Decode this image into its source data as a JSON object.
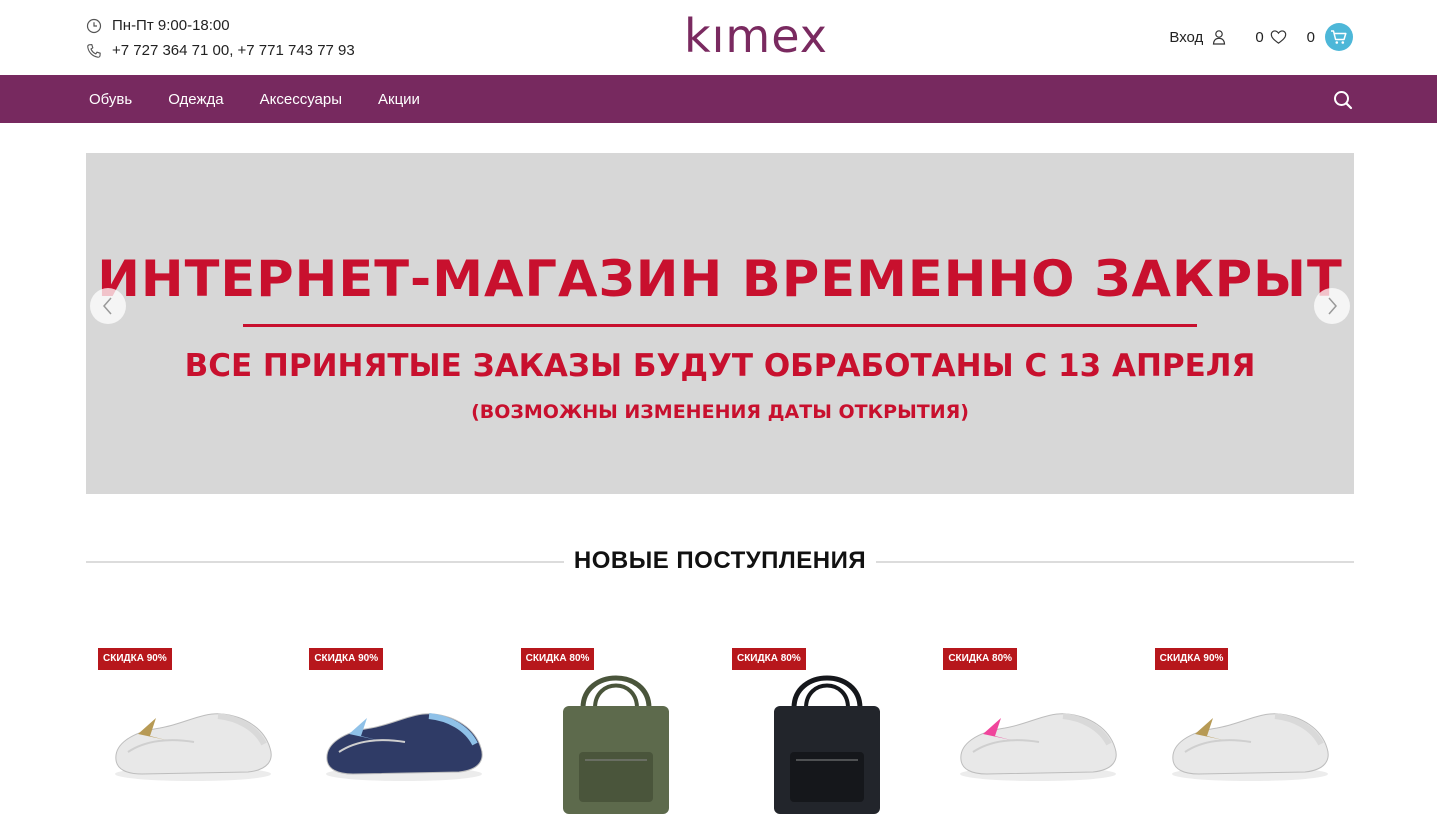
{
  "header": {
    "hours": "Пн-Пт 9:00-18:00",
    "phones": "+7 727 364 71 00, +7 771 743 77 93",
    "logo": "kımex",
    "login_label": "Вход",
    "favorites_count": "0",
    "cart_count": "0"
  },
  "nav": {
    "items": [
      "Обувь",
      "Одежда",
      "Аксессуары",
      "Акции"
    ]
  },
  "banner": {
    "title": "ИНТЕРНЕТ-МАГАЗИН ВРЕМЕННО ЗАКРЫТ",
    "subtitle": "ВСЕ ПРИНЯТЫЕ ЗАКАЗЫ БУДУТ ОБРАБОТАНЫ С 13 АПРЕЛЯ",
    "note": "(ВОЗМОЖНЫ ИЗМЕНЕНИЯ ДАТЫ ОТКРЫТИЯ)"
  },
  "section": {
    "title": "НОВЫЕ ПОСТУПЛЕНИЯ"
  },
  "products": [
    {
      "badge": "СКИДКА 90%",
      "kind": "slipper",
      "color": "#e8e8e8",
      "accent": "#b79a55"
    },
    {
      "badge": "СКИДКА 90%",
      "kind": "slipper",
      "color": "#2f3b66",
      "accent": "#8fc1e8"
    },
    {
      "badge": "СКИДКА 80%",
      "kind": "bag",
      "color": "#5d6a4c",
      "accent": "#4a553b"
    },
    {
      "badge": "СКИДКА 80%",
      "kind": "bag",
      "color": "#22252b",
      "accent": "#15171b"
    },
    {
      "badge": "СКИДКА 80%",
      "kind": "slipper",
      "color": "#e8e8e8",
      "accent": "#f0459c"
    },
    {
      "badge": "СКИДКА 90%",
      "kind": "slipper",
      "color": "#e8e8e8",
      "accent": "#b79a55"
    }
  ],
  "colors": {
    "brand": "#77295f",
    "banner_text": "#c8102e",
    "badge": "#b7171c",
    "cart": "#4db7d8"
  }
}
